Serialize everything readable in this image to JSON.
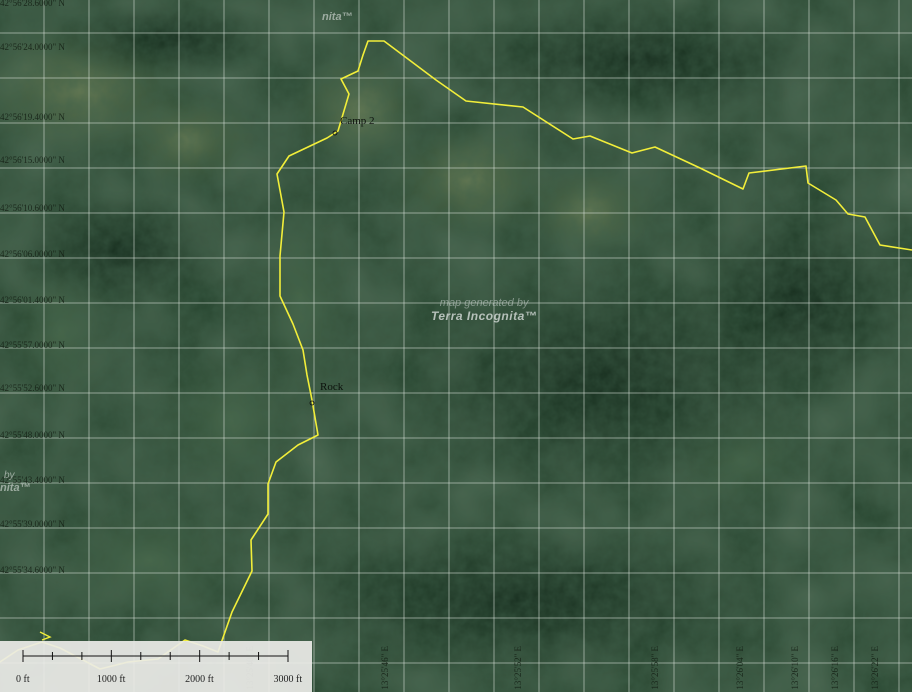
{
  "map": {
    "watermark": {
      "line1": "map generated by",
      "line2": "Terra Incognita™",
      "partial_top": "nita™",
      "partial_left_1": "by",
      "partial_left_2": "nita™"
    },
    "labels": {
      "camp": "Camp 2",
      "rock": "Rock"
    },
    "lat_labels": [
      "42°56'28.6000\" N",
      "42°56'24.0000\" N",
      "42°56'19.4000\" N",
      "42°56'15.0000\" N",
      "42°56'10.6000\" N",
      "42°56'06.0000\" N",
      "42°56'01.4000\" N",
      "42°55'57.0000\" N",
      "42°55'52.6000\" N",
      "42°55'48.0000\" N",
      "42°55'43.4000\" N",
      "42°55'39.0000\" N",
      "42°55'34.6000\" N"
    ],
    "lng_labels": [
      "13°25'40\" E",
      "13°25'46\" E",
      "13°25'52\" E",
      "13°25'58\" E",
      "13°26'04\" E",
      "13°26'10\" E",
      "13°26'16\" E",
      "13°26'22\" E"
    ],
    "scale": {
      "labels": [
        "0 ft",
        "1000 ft",
        "2000 ft",
        "3000 ft"
      ]
    },
    "colors": {
      "trail": "#f2ee3a",
      "grid": "#e8ece8",
      "forest": "#1f3b26",
      "meadow": "#5c7048"
    }
  }
}
